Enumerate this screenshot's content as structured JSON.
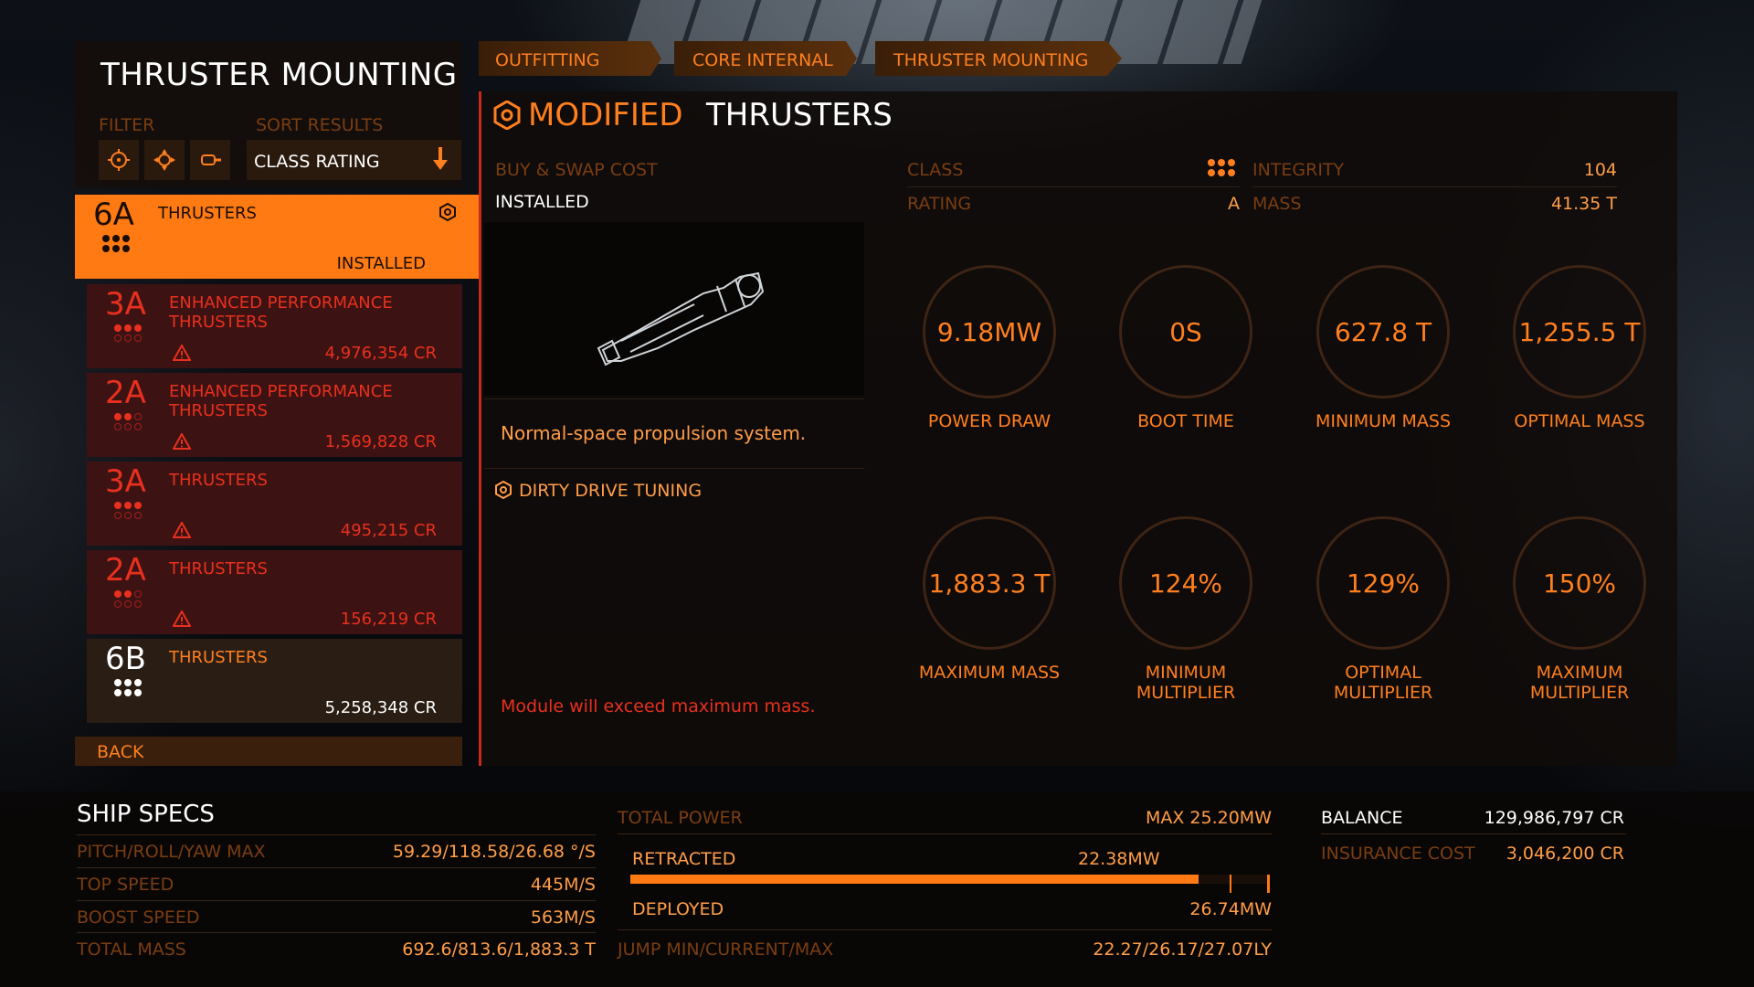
{
  "header": {
    "title": "THRUSTER MOUNTING",
    "filter_label": "FILTER",
    "sort_label": "SORT RESULTS",
    "sort_value": "CLASS RATING"
  },
  "breadcrumbs": [
    "OUTFITTING",
    "CORE INTERNAL",
    "THRUSTER MOUNTING"
  ],
  "modules": [
    {
      "class": "6A",
      "name_line1": "THRUSTERS",
      "name_line2": "",
      "right_text": "INSTALLED",
      "variant": "installed",
      "dots": 6,
      "dots_hollow": 0,
      "warning": false
    },
    {
      "class": "3A",
      "name_line1": "ENHANCED PERFORMANCE",
      "name_line2": "THRUSTERS",
      "right_text": "4,976,354 CR",
      "variant": "red",
      "dots": 3,
      "dots_hollow": 3,
      "warning": true
    },
    {
      "class": "2A",
      "name_line1": "ENHANCED PERFORMANCE",
      "name_line2": "THRUSTERS",
      "right_text": "1,569,828 CR",
      "variant": "red",
      "dots": 2,
      "dots_hollow": 4,
      "warning": true
    },
    {
      "class": "3A",
      "name_line1": "THRUSTERS",
      "name_line2": "",
      "right_text": "495,215 CR",
      "variant": "red",
      "dots": 3,
      "dots_hollow": 3,
      "warning": true
    },
    {
      "class": "2A",
      "name_line1": "THRUSTERS",
      "name_line2": "",
      "right_text": "156,219 CR",
      "variant": "red",
      "dots": 2,
      "dots_hollow": 4,
      "warning": true
    },
    {
      "class": "6B",
      "name_line1": "THRUSTERS",
      "name_line2": "",
      "right_text": "5,258,348 CR",
      "variant": "gray",
      "dots": 6,
      "dots_hollow": 0,
      "warning": false
    }
  ],
  "back_label": "BACK",
  "detail": {
    "modified_label": "MODIFIED",
    "module_name": "THRUSTERS",
    "cost_label": "BUY & SWAP COST",
    "cost_value": "INSTALLED",
    "description": "Normal-space propulsion system.",
    "engineering": "DIRTY DRIVE TUNING",
    "warning": "Module will exceed maximum mass.",
    "stats": {
      "class_label": "CLASS",
      "rating_label": "RATING",
      "rating_value": "A",
      "integrity_label": "INTEGRITY",
      "integrity_value": "104",
      "mass_label": "MASS",
      "mass_value": "41.35 T"
    },
    "rings": [
      {
        "value": "9.18MW",
        "label1": "POWER DRAW",
        "label2": ""
      },
      {
        "value": "0S",
        "label1": "BOOT TIME",
        "label2": ""
      },
      {
        "value": "627.8 T",
        "label1": "MINIMUM MASS",
        "label2": ""
      },
      {
        "value": "1,255.5 T",
        "label1": "OPTIMAL MASS",
        "label2": ""
      },
      {
        "value": "1,883.3 T",
        "label1": "MAXIMUM MASS",
        "label2": ""
      },
      {
        "value": "124%",
        "label1": "MINIMUM",
        "label2": "MULTIPLIER"
      },
      {
        "value": "129%",
        "label1": "OPTIMAL",
        "label2": "MULTIPLIER"
      },
      {
        "value": "150%",
        "label1": "MAXIMUM",
        "label2": "MULTIPLIER"
      }
    ]
  },
  "ship_specs": {
    "title": "SHIP SPECS",
    "rows": [
      {
        "label": "PITCH/ROLL/YAW MAX",
        "value": "59.29/118.58/26.68 °/S"
      },
      {
        "label": "TOP SPEED",
        "value": "445M/S"
      },
      {
        "label": "BOOST SPEED",
        "value": "563M/S"
      },
      {
        "label": "TOTAL MASS",
        "value": "692.6/813.6/1,883.3 T"
      }
    ]
  },
  "power": {
    "total_label": "TOTAL POWER",
    "total_value": "MAX 25.20MW",
    "retracted_label": "RETRACTED",
    "retracted_value": "22.38MW",
    "deployed_label": "DEPLOYED",
    "deployed_value": "26.74MW",
    "retracted_fraction": 0.888,
    "jump_label": "JUMP MIN/CURRENT/MAX",
    "jump_value": "22.27/26.17/27.07LY"
  },
  "account": {
    "balance_label": "BALANCE",
    "balance_value": "129,986,797 CR",
    "insurance_label": "INSURANCE COST",
    "insurance_value": "3,046,200 CR"
  },
  "colors": {
    "accent": "#ff7a12",
    "warning_red": "#e8301e",
    "row_red": "#3d1212"
  }
}
